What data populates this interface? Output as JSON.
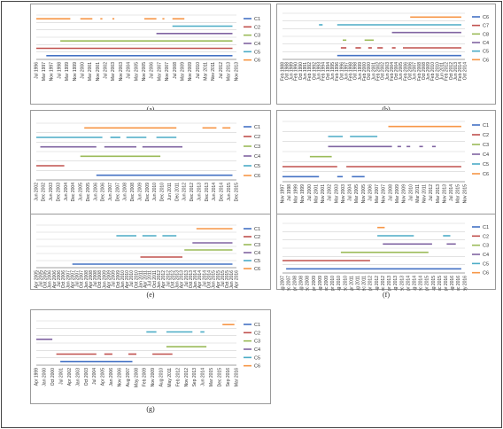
{
  "figure": {
    "labels": [
      "(a)",
      "(b)",
      "(c)",
      "(d)",
      "(e)",
      "(f)",
      "(g)"
    ]
  },
  "chart_data": [
    {
      "type": "gantt",
      "label": "(a)",
      "legend": [
        "C1",
        "C2",
        "C3",
        "C4",
        "C5",
        "C6"
      ],
      "colors": [
        "#4472C4",
        "#C0504D",
        "#9BBB59",
        "#8064A2",
        "#4BACC6",
        "#F79646"
      ],
      "x_ticks": [
        "Jul 1996",
        "Mar 1997",
        "Nov 1997",
        "Jul 1998",
        "Mar 1999",
        "Nov 1999",
        "Jul 2000",
        "Mar 2001",
        "Nov 2001",
        "Jul 2002",
        "Mar 2003",
        "Nov 2003",
        "Jul 2004",
        "Mar 2005",
        "Nov 2005",
        "Jul 2006",
        "Mar 2007",
        "Nov 2007",
        "Jul 2008",
        "Mar 2009",
        "Nov 2009",
        "Jul 2010",
        "Mar 2011",
        "Nov 2011",
        "Jul 2012",
        "Mar 2013",
        "Nov 2013"
      ],
      "series": [
        {
          "name": "C1",
          "segments": [
            [
              0.05,
              0.98
            ]
          ]
        },
        {
          "name": "C2",
          "segments": [
            [
              0.0,
              0.98
            ]
          ]
        },
        {
          "name": "C3",
          "segments": [
            [
              0.12,
              0.98
            ]
          ]
        },
        {
          "name": "C4",
          "segments": [
            [
              0.6,
              0.98
            ]
          ]
        },
        {
          "name": "C5",
          "segments": [
            [
              0.68,
              0.98
            ]
          ]
        },
        {
          "name": "C6",
          "segments": [
            [
              0.0,
              0.17
            ],
            [
              0.22,
              0.28
            ],
            [
              0.32,
              0.33
            ],
            [
              0.38,
              0.39
            ],
            [
              0.54,
              0.6
            ],
            [
              0.63,
              0.64
            ],
            [
              0.68,
              0.74
            ]
          ]
        }
      ]
    },
    {
      "type": "gantt",
      "label": "(b)",
      "legend": [
        "C6",
        "C7",
        "C8",
        "C4",
        "C5",
        "C6"
      ],
      "colors": [
        "#4472C4",
        "#C0504D",
        "#9BBB59",
        "#8064A2",
        "#4BACC6",
        "#F79646"
      ],
      "x_ticks": [
        "Feb 1988",
        "Oct 1988",
        "Jun 1989",
        "Feb 1990",
        "Oct 1990",
        "Jun 1991",
        "Feb 1992",
        "Oct 1992",
        "Jun 1993",
        "Feb 1994",
        "Oct 1994",
        "Jun 1995",
        "Feb 1996",
        "Oct 1996",
        "Jun 1997",
        "Feb 1998",
        "Oct 1998",
        "Jun 1999",
        "Feb 2000",
        "Oct 2000",
        "Jun 2001",
        "Feb 2002",
        "Oct 2002",
        "Jun 2003",
        "Feb 2004",
        "Oct 2004",
        "Jun 2005",
        "Feb 2006",
        "Oct 2006",
        "Jun 2007",
        "Feb 2008",
        "Oct 2008",
        "Jun 2009",
        "Feb 2010",
        "Oct 2010",
        "Jun 2011",
        "Feb 2012",
        "Oct 2012",
        "Jun 2013",
        "Feb 2014",
        "Oct 2014"
      ],
      "series": [
        {
          "name": "C1",
          "segments": [
            [
              0.3,
              0.98
            ]
          ]
        },
        {
          "name": "C2",
          "segments": [
            [
              0.32,
              0.35
            ],
            [
              0.4,
              0.43
            ],
            [
              0.47,
              0.49
            ],
            [
              0.52,
              0.55
            ],
            [
              0.6,
              0.62
            ],
            [
              0.66,
              0.98
            ]
          ]
        },
        {
          "name": "C3",
          "segments": [
            [
              0.33,
              0.35
            ],
            [
              0.45,
              0.5
            ]
          ]
        },
        {
          "name": "C4",
          "segments": [
            [
              0.6,
              0.98
            ]
          ]
        },
        {
          "name": "C5",
          "segments": [
            [
              0.2,
              0.22
            ],
            [
              0.3,
              0.98
            ]
          ]
        },
        {
          "name": "C6",
          "segments": [
            [
              0.7,
              0.98
            ]
          ]
        }
      ]
    },
    {
      "type": "gantt",
      "label": "(c)",
      "legend": [
        "C1",
        "C2",
        "C3",
        "C4",
        "C5",
        "C6"
      ],
      "colors": [
        "#4472C4",
        "#C0504D",
        "#9BBB59",
        "#8064A2",
        "#4BACC6",
        "#F79646"
      ],
      "x_ticks": [
        "Jun 2002",
        "Dec 2002",
        "Jun 2003",
        "Dec 2003",
        "Jun 2004",
        "Dec 2004",
        "Jun 2005",
        "Dec 2005",
        "Jun 2006",
        "Dec 2006",
        "Jun 2007",
        "Dec 2007",
        "Jun 2008",
        "Dec 2008",
        "Jun 2009",
        "Dec 2009",
        "Jun 2010",
        "Dec 2010",
        "Jun 2011",
        "Dec 2011",
        "Jun 2012",
        "Dec 2012",
        "Jun 2013",
        "Dec 2013",
        "Jun 2014",
        "Dec 2014",
        "Jun 2015",
        "Dec 2015"
      ],
      "series": [
        {
          "name": "C1",
          "segments": [
            [
              0.3,
              0.98
            ]
          ]
        },
        {
          "name": "C2",
          "segments": [
            [
              0.0,
              0.14
            ]
          ]
        },
        {
          "name": "C3",
          "segments": [
            [
              0.22,
              0.62
            ]
          ]
        },
        {
          "name": "C4",
          "segments": [
            [
              0.02,
              0.3
            ],
            [
              0.34,
              0.5
            ],
            [
              0.53,
              0.73
            ]
          ]
        },
        {
          "name": "C5",
          "segments": [
            [
              0.0,
              0.33
            ],
            [
              0.37,
              0.42
            ],
            [
              0.45,
              0.55
            ],
            [
              0.6,
              0.7
            ]
          ]
        },
        {
          "name": "C6",
          "segments": [
            [
              0.24,
              0.7
            ],
            [
              0.83,
              0.9
            ],
            [
              0.93,
              0.97
            ]
          ]
        }
      ]
    },
    {
      "type": "gantt",
      "label": "(d)",
      "legend": [
        "C1",
        "C2",
        "C3",
        "C4",
        "C5",
        "C6"
      ],
      "colors": [
        "#4472C4",
        "#C0504D",
        "#9BBB59",
        "#8064A2",
        "#4BACC6",
        "#F79646"
      ],
      "x_ticks": [
        "Nov 1997",
        "Jul 1998",
        "Mar 1999",
        "Nov 1999",
        "Jul 2000",
        "Mar 2001",
        "Nov 2001",
        "Jul 2002",
        "Mar 2003",
        "Nov 2003",
        "Jul 2004",
        "Mar 2005",
        "Nov 2005",
        "Jul 2006",
        "Mar 2007",
        "Nov 2007",
        "Jul 2008",
        "Mar 2009",
        "Nov 2009",
        "Jul 2010",
        "Mar 2011",
        "Nov 2011",
        "Jul 2012",
        "Mar 2013",
        "Nov 2013",
        "Jul 2014",
        "Mar 2015",
        "Nov 2015"
      ],
      "series": [
        {
          "name": "C1",
          "segments": [
            [
              0.0,
              0.2
            ],
            [
              0.3,
              0.33
            ],
            [
              0.38,
              0.45
            ]
          ]
        },
        {
          "name": "C2",
          "segments": [
            [
              0.0,
              0.3
            ],
            [
              0.35,
              0.98
            ]
          ]
        },
        {
          "name": "C3",
          "segments": [
            [
              0.15,
              0.27
            ]
          ]
        },
        {
          "name": "C4",
          "segments": [
            [
              0.25,
              0.6
            ],
            [
              0.63,
              0.65
            ],
            [
              0.68,
              0.7
            ],
            [
              0.75,
              0.77
            ],
            [
              0.82,
              0.84
            ]
          ]
        },
        {
          "name": "C5",
          "segments": [
            [
              0.25,
              0.33
            ],
            [
              0.37,
              0.52
            ]
          ]
        },
        {
          "name": "C6",
          "segments": [
            [
              0.58,
              0.98
            ]
          ]
        }
      ]
    },
    {
      "type": "gantt",
      "label": "(e)",
      "legend": [
        "C1",
        "C2",
        "C3",
        "C4",
        "C5",
        "C6"
      ],
      "colors": [
        "#4472C4",
        "#C0504D",
        "#9BBB59",
        "#8064A2",
        "#4BACC6",
        "#F79646"
      ],
      "x_ticks": [
        "Apr 2005",
        "Jul 2005",
        "Oct 2005",
        "Jan 2006",
        "Apr 2006",
        "Jul 2006",
        "Oct 2006",
        "Jan 2007",
        "Apr 2007",
        "Jul 2007",
        "Oct 2007",
        "Jan 2008",
        "Apr 2008",
        "Jul 2008",
        "Oct 2008",
        "Jan 2009",
        "Apr 2009",
        "Jul 2009",
        "Oct 2009",
        "Jan 2010",
        "Apr 2010",
        "Jul 2010",
        "Oct 2010",
        "Jan 2011",
        "Apr 2011",
        "Jul 2011",
        "Oct 2011",
        "Jan 2012",
        "Apr 2012",
        "Jul 2012",
        "Oct 2012",
        "Jan 2013",
        "Apr 2013",
        "Jul 2013",
        "Oct 2013",
        "Jan 2014",
        "Apr 2014",
        "Jul 2014",
        "Oct 2014",
        "Jan 2015",
        "Apr 2015",
        "Jul 2015",
        "Oct 2015",
        "Jan 2016",
        "Apr 2016"
      ],
      "series": [
        {
          "name": "C1",
          "segments": [
            [
              0.18,
              0.98
            ]
          ]
        },
        {
          "name": "C2",
          "segments": [
            [
              0.52,
              0.73
            ]
          ]
        },
        {
          "name": "C3",
          "segments": [
            [
              0.74,
              0.98
            ]
          ]
        },
        {
          "name": "C4",
          "segments": [
            [
              0.78,
              0.98
            ]
          ]
        },
        {
          "name": "C5",
          "segments": [
            [
              0.4,
              0.5
            ],
            [
              0.53,
              0.6
            ],
            [
              0.63,
              0.7
            ]
          ]
        },
        {
          "name": "C6",
          "segments": [
            [
              0.8,
              0.98
            ]
          ]
        }
      ]
    },
    {
      "type": "gantt",
      "label": "(f)",
      "legend": [
        "C1",
        "C2",
        "C3",
        "C4",
        "C5",
        "C6"
      ],
      "colors": [
        "#4472C4",
        "#C0504D",
        "#9BBB59",
        "#8064A2",
        "#4BACC6",
        "#F79646"
      ],
      "x_ticks": [
        "Aug 2007",
        "Dec 2007",
        "Apr 2008",
        "Aug 2008",
        "Dec 2008",
        "Apr 2009",
        "Aug 2009",
        "Dec 2009",
        "Apr 2010",
        "Aug 2010",
        "Dec 2010",
        "Apr 2011",
        "Aug 2011",
        "Dec 2011",
        "Apr 2012",
        "Aug 2012",
        "Dec 2012",
        "Apr 2013",
        "Aug 2013",
        "Dec 2013",
        "Apr 2014",
        "Aug 2014",
        "Dec 2014",
        "Apr 2015",
        "Aug 2015",
        "Dec 2015",
        "Apr 2016",
        "Aug 2016",
        "Dec 2016",
        "May 2016"
      ],
      "series": [
        {
          "name": "C1",
          "segments": [
            [
              0.02,
              0.98
            ]
          ]
        },
        {
          "name": "C2",
          "segments": [
            [
              0.0,
              0.48
            ]
          ]
        },
        {
          "name": "C3",
          "segments": [
            [
              0.32,
              0.8
            ]
          ]
        },
        {
          "name": "C4",
          "segments": [
            [
              0.55,
              0.82
            ],
            [
              0.9,
              0.95
            ]
          ]
        },
        {
          "name": "C5",
          "segments": [
            [
              0.52,
              0.72
            ],
            [
              0.88,
              0.92
            ]
          ]
        },
        {
          "name": "C6",
          "segments": [
            [
              0.52,
              0.56
            ]
          ]
        }
      ]
    },
    {
      "type": "gantt",
      "label": "(g)",
      "legend": [
        "C1",
        "C2",
        "C3",
        "C4",
        "C5",
        "C6"
      ],
      "colors": [
        "#4472C4",
        "#C0504D",
        "#9BBB59",
        "#8064A2",
        "#4BACC6",
        "#F79646"
      ],
      "x_ticks": [
        "Apr 1999",
        "Jan 2000",
        "Oct 2000",
        "Jul 2001",
        "Apr 2002",
        "Jan 2003",
        "Oct 2003",
        "Jul 2004",
        "Apr 2005",
        "Jan 2006",
        "Nov 2006",
        "Aug 2007",
        "May 2008",
        "Feb 2009",
        "Nov 2009",
        "Aug 2010",
        "May 2011",
        "Feb 2012",
        "Nov 2012",
        "Sep 2013",
        "Jun 2014",
        "Mar 2015",
        "Dec 2015",
        "Sep 2016",
        "Mar 2016"
      ],
      "series": [
        {
          "name": "C1",
          "segments": [
            [
              0.12,
              0.48
            ]
          ]
        },
        {
          "name": "C2",
          "segments": [
            [
              0.1,
              0.3
            ],
            [
              0.34,
              0.38
            ],
            [
              0.46,
              0.5
            ],
            [
              0.58,
              0.68
            ]
          ]
        },
        {
          "name": "C3",
          "segments": [
            [
              0.65,
              0.85
            ]
          ]
        },
        {
          "name": "C4",
          "segments": [
            [
              0.0,
              0.08
            ]
          ]
        },
        {
          "name": "C5",
          "segments": [
            [
              0.55,
              0.6
            ],
            [
              0.65,
              0.78
            ],
            [
              0.82,
              0.84
            ]
          ]
        },
        {
          "name": "C6",
          "segments": [
            [
              0.93,
              0.99
            ]
          ]
        }
      ]
    }
  ]
}
